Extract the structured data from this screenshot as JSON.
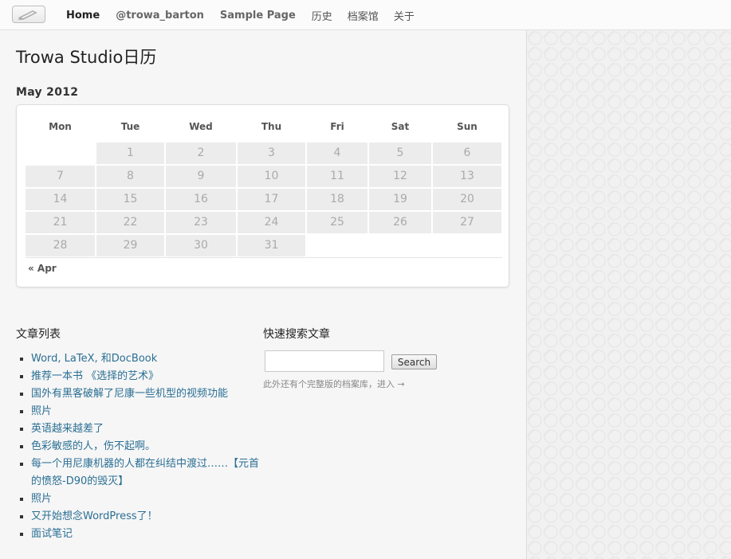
{
  "nav": {
    "items": [
      "Home",
      "@trowa_barton",
      "Sample Page",
      "历史",
      "档案馆",
      "关于"
    ]
  },
  "page": {
    "title": "Trowa Studio日历"
  },
  "calendar": {
    "month": "May 2012",
    "weekdays": [
      "Mon",
      "Tue",
      "Wed",
      "Thu",
      "Fri",
      "Sat",
      "Sun"
    ],
    "first_weekday_index": 1,
    "days_in_month": 31,
    "prev_link": "« Apr"
  },
  "posts": {
    "title": "文章列表",
    "items": [
      "Word, LaTeX, 和DocBook",
      "推荐一本书 《选择的艺术》",
      "国外有黑客破解了尼康一些机型的视频功能",
      "照片",
      "英语越来越差了",
      "色彩敏感的人，伤不起啊。",
      "每一个用尼康机器的人都在纠结中渡过……【元首的愤怒-D90的毁灭】",
      "照片",
      "又开始想念WordPress了！",
      "面试笔记"
    ]
  },
  "search": {
    "title": "快速搜索文章",
    "input_value": "",
    "button_label": "Search",
    "note_prefix": "此外还有个完整版的档案库，进入",
    "note_link": "→"
  }
}
